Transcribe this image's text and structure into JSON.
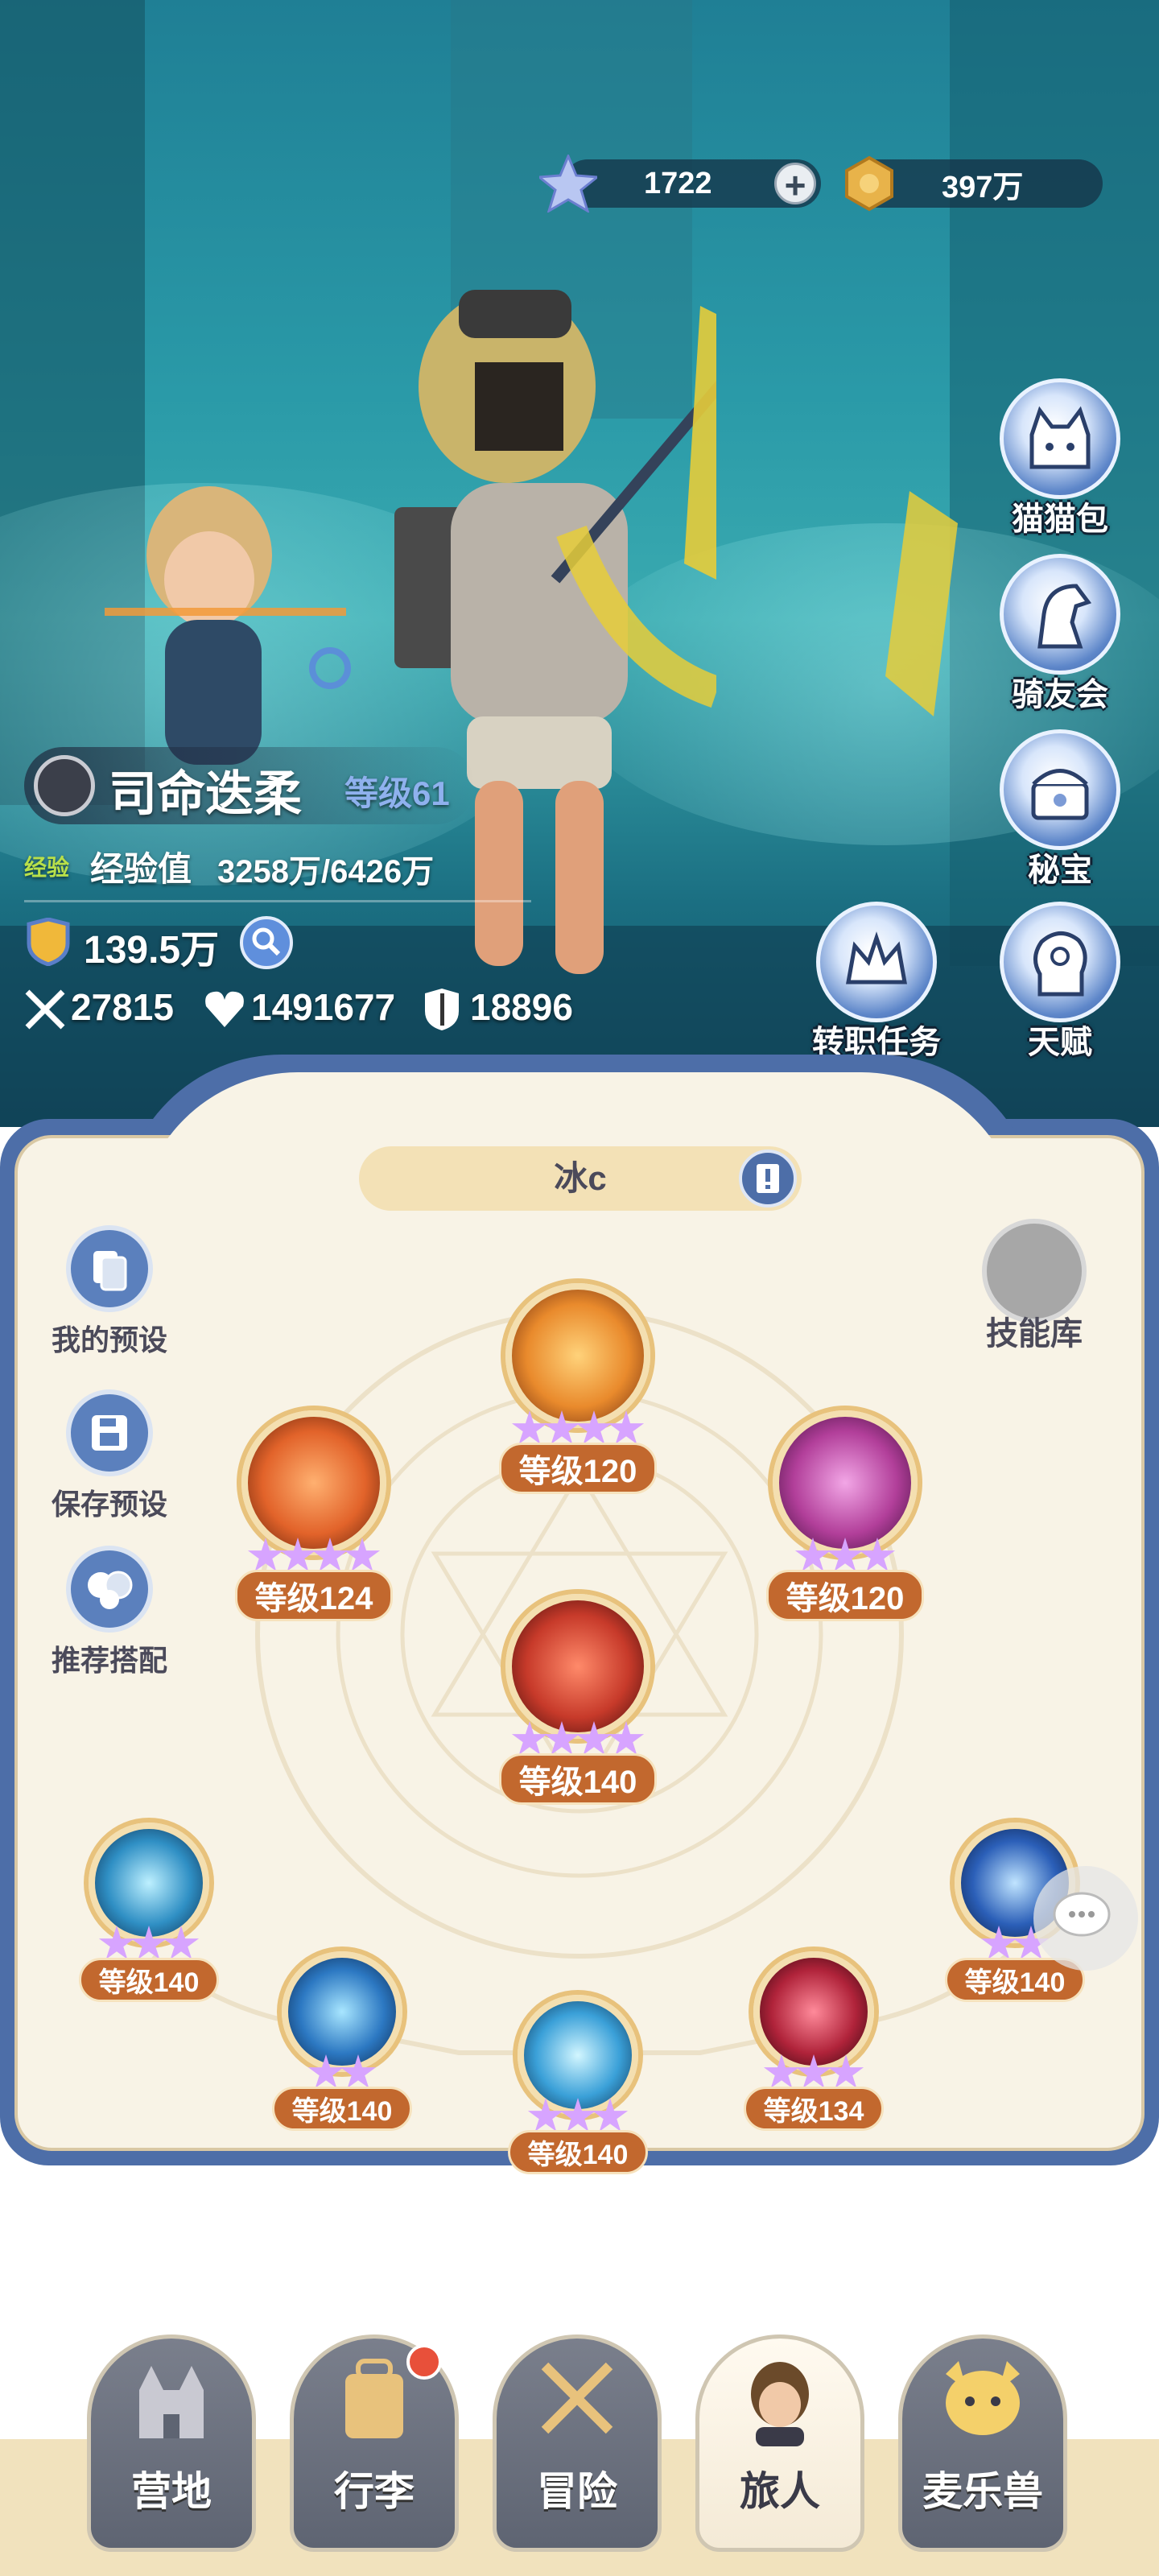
{
  "currency": {
    "stars": {
      "icon": "star-crystal-icon",
      "value": "1722",
      "plus": "+"
    },
    "gold": {
      "icon": "gold-coin-icon",
      "value": "397万"
    }
  },
  "side_menu": [
    {
      "label": "猫猫包",
      "icon": "cat-bag-icon"
    },
    {
      "label": "骑友会",
      "icon": "horse-icon"
    },
    {
      "label": "秘宝",
      "icon": "treasure-chest-icon"
    },
    {
      "label": "转职任务",
      "icon": "crown-icon"
    },
    {
      "label": "天赋",
      "icon": "brain-head-icon"
    }
  ],
  "character": {
    "name": "司命迭柔",
    "level_text": "等级61",
    "exp_badge": "经验",
    "exp_label": "经验值",
    "exp_value": "3258万/6426万",
    "power": "139.5万",
    "attack": "27815",
    "hp": "1491677",
    "defense": "18896"
  },
  "panel": {
    "preset_name": "冰c",
    "tools": [
      {
        "label": "我的预设",
        "icon": "preset-cards-icon"
      },
      {
        "label": "保存预设",
        "icon": "save-icon"
      },
      {
        "label": "推荐搭配",
        "icon": "recommend-icon"
      }
    ],
    "skill_library": "技能库",
    "skills": [
      {
        "level": "等级120",
        "stars": 4,
        "color": "#e98a2c"
      },
      {
        "level": "等级124",
        "stars": 4,
        "color": "#e2632a"
      },
      {
        "level": "等级120",
        "stars": 3,
        "color": "#b23f9a"
      },
      {
        "level": "等级140",
        "stars": 4,
        "color": "#c73a2a"
      },
      {
        "level": "等级140",
        "stars": 3,
        "color": "#2f8fc4"
      },
      {
        "level": "等级140",
        "stars": 2,
        "color": "#2c78c2"
      },
      {
        "level": "等级140",
        "stars": 3,
        "color": "#3aa0d8"
      },
      {
        "level": "等级134",
        "stars": 3,
        "color": "#b0233a"
      },
      {
        "level": "等级140",
        "stars": 2,
        "color": "#2b5fb8"
      }
    ]
  },
  "nav": [
    {
      "label": "营地",
      "icon": "castle-icon"
    },
    {
      "label": "行李",
      "icon": "backpack-icon"
    },
    {
      "label": "冒险",
      "icon": "crossed-swords-icon"
    },
    {
      "label": "旅人",
      "icon": "traveler-avatar-icon"
    },
    {
      "label": "麦乐兽",
      "icon": "pet-face-icon"
    }
  ]
}
